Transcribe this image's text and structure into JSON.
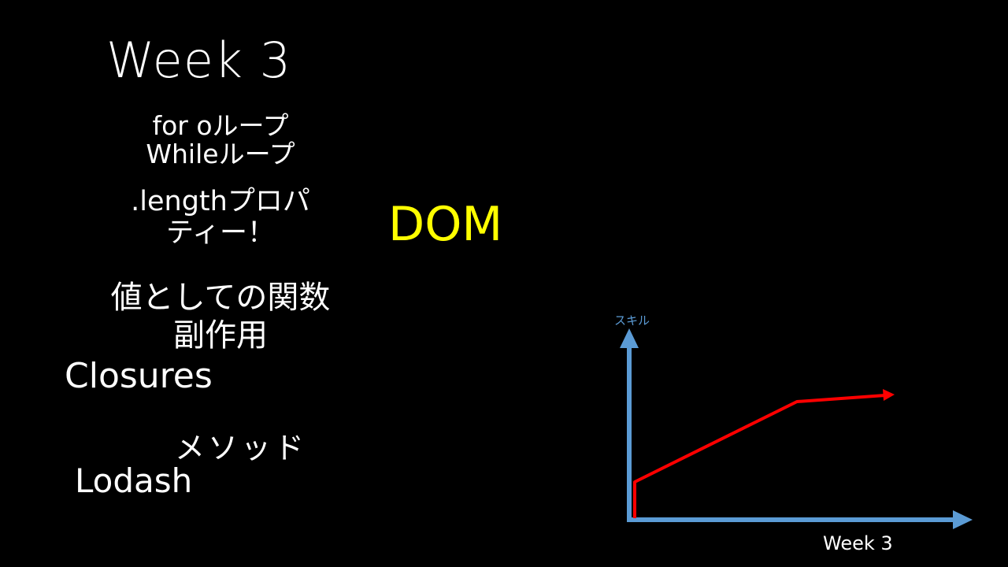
{
  "slide": {
    "title": "Week 3",
    "loops": {
      "line1": "for oループ",
      "line2": "Whileループ"
    },
    "length_property": {
      "line1": ".lengthプロパ",
      "line2": "ティー！"
    },
    "functions": {
      "line1": "値としての関数",
      "line2": "副作用"
    },
    "closures": "Closures",
    "methods": "メソッド",
    "lodash": "Lodash",
    "dom": "DOM"
  },
  "graph": {
    "y_axis_label": "スキル",
    "x_axis_label": "Week 3",
    "colors": {
      "axes": "#5b9bd5",
      "curve": "#ff0000",
      "highlight": "#ffff00"
    }
  }
}
